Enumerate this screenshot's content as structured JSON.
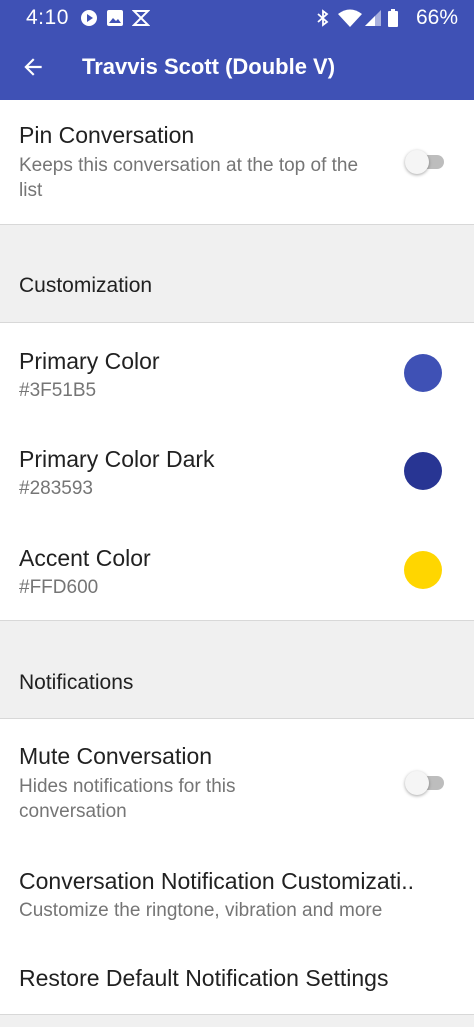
{
  "status_bar": {
    "time": "4:10",
    "battery": "66%",
    "icons": [
      "media-icon",
      "image-icon",
      "app-icon",
      "bluetooth-icon",
      "wifi-icon",
      "signal-icon",
      "battery-icon"
    ]
  },
  "app_bar": {
    "title": "Travvis Scott (Double V)",
    "back_icon": "arrow-back-icon"
  },
  "pin": {
    "title": "Pin Conversation",
    "subtitle": "Keeps this conversation at the top of the list",
    "enabled": false
  },
  "customization": {
    "header": "Customization",
    "items": [
      {
        "title": "Primary Color",
        "value": "#3F51B5",
        "swatch": "#3f51b5"
      },
      {
        "title": "Primary Color Dark",
        "value": "#283593",
        "swatch": "#283593"
      },
      {
        "title": "Accent Color",
        "value": "#FFD600",
        "swatch": "#ffd600"
      }
    ]
  },
  "notifications": {
    "header": "Notifications",
    "mute": {
      "title": "Mute Conversation",
      "subtitle": "Hides notifications for this conversation",
      "enabled": false
    },
    "customize": {
      "title": "Conversation Notification Customizati..",
      "subtitle": "Customize the ringtone, vibration and more"
    },
    "restore": {
      "title": "Restore Default Notification Settings"
    }
  },
  "colors": {
    "primary": "#3f51b5",
    "toggle_off": "#bdbdbd"
  }
}
